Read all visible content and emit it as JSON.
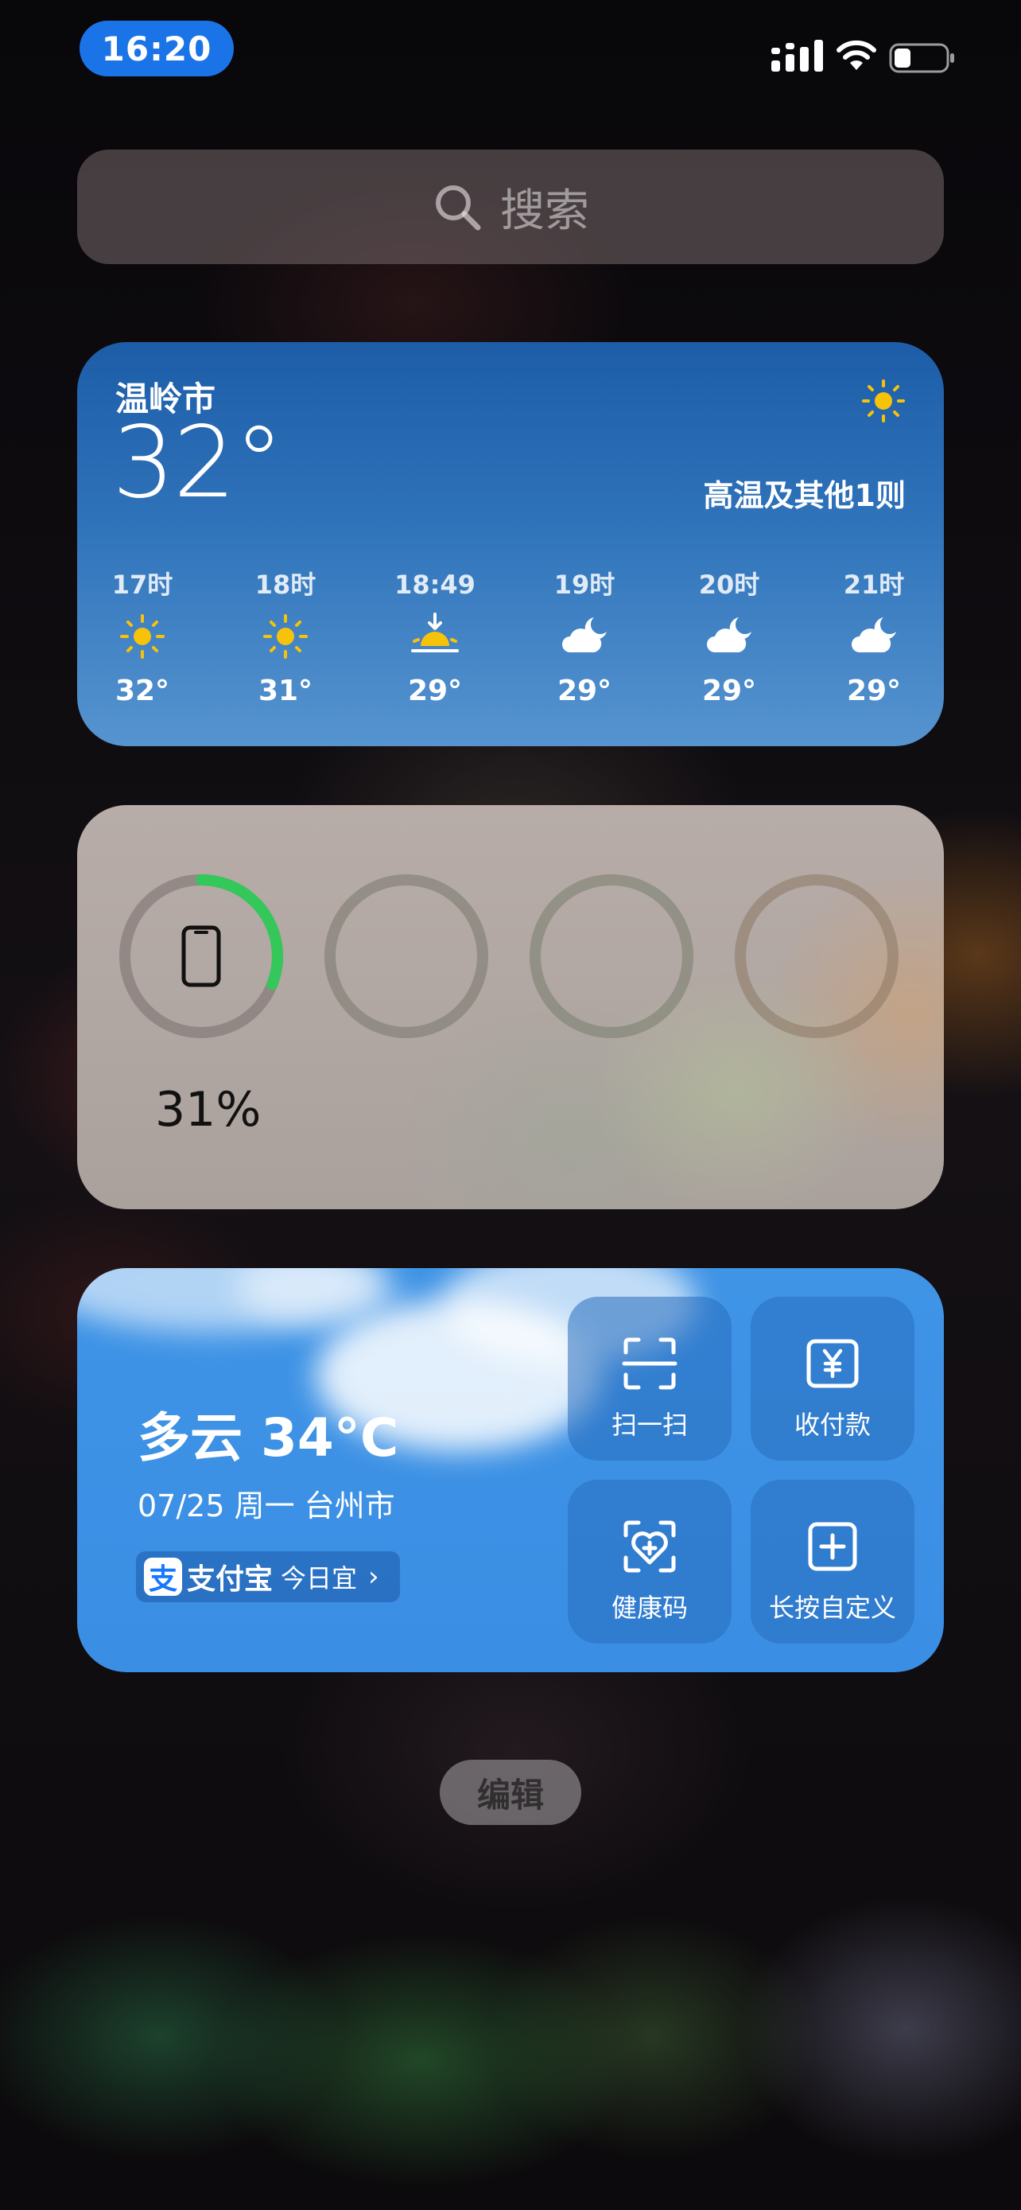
{
  "status_bar": {
    "time": "16:20",
    "icons": [
      "cellular-signal-icon",
      "wifi-icon",
      "battery-icon"
    ]
  },
  "search": {
    "placeholder": "搜索",
    "icon": "search-icon"
  },
  "weather_widget": {
    "city": "温岭市",
    "temperature": "32°",
    "condition_icon": "sun-icon",
    "alert": "高温及其他1则",
    "hourly": [
      {
        "time": "17时",
        "icon": "sun-icon",
        "temp": "32°"
      },
      {
        "time": "18时",
        "icon": "sun-icon",
        "temp": "31°"
      },
      {
        "time": "18:49",
        "icon": "sunset-icon",
        "temp": "29°"
      },
      {
        "time": "19时",
        "icon": "cloud-moon-icon",
        "temp": "29°"
      },
      {
        "time": "20时",
        "icon": "cloud-moon-icon",
        "temp": "29°"
      },
      {
        "time": "21时",
        "icon": "cloud-moon-icon",
        "temp": "29°"
      }
    ]
  },
  "battery_widget": {
    "device_icon": "iphone-icon",
    "percent_label": "31%",
    "percent_value": 31,
    "ring_color": "#34c759",
    "empty_slots": 3
  },
  "alipay_widget": {
    "weather": "多云 34°C",
    "date_line": "07/25 周一 台州市",
    "brand": "支付宝",
    "brand_logo_char": "支",
    "brand_tag": "今日宜",
    "chevron": "›",
    "actions": [
      {
        "label": "扫一扫",
        "icon": "scan-icon"
      },
      {
        "label": "收付款",
        "icon": "payment-icon"
      },
      {
        "label": "健康码",
        "icon": "health-code-icon"
      },
      {
        "label": "长按自定义",
        "icon": "add-icon"
      }
    ]
  },
  "edit_button": {
    "label": "编辑"
  }
}
